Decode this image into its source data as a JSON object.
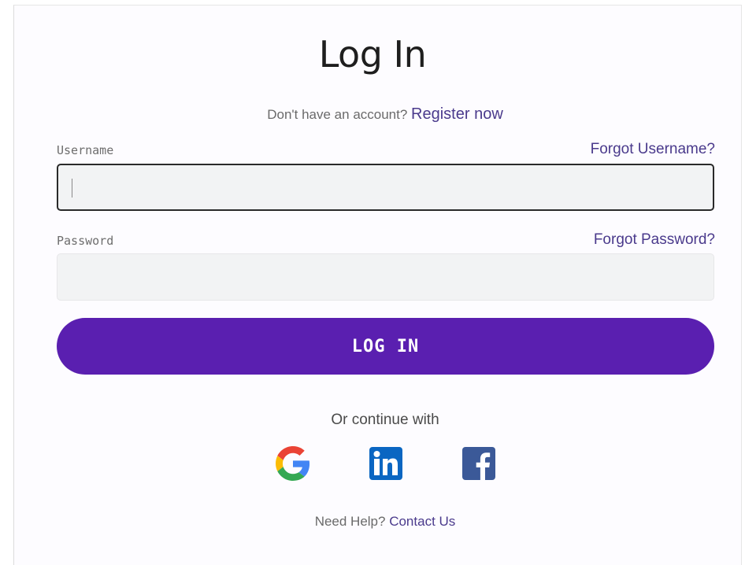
{
  "page": {
    "title": "Log In"
  },
  "register": {
    "prompt": "Don't have an account?",
    "link": "Register now"
  },
  "username": {
    "label": "Username",
    "forgot_link": "Forgot Username?",
    "value": ""
  },
  "password": {
    "label": "Password",
    "forgot_link": "Forgot Password?",
    "value": ""
  },
  "login_button": {
    "label": "LOG IN"
  },
  "social": {
    "prompt": "Or continue with",
    "providers": [
      {
        "name": "Google",
        "icon": "google-icon"
      },
      {
        "name": "LinkedIn",
        "icon": "linkedin-icon"
      },
      {
        "name": "Facebook",
        "icon": "facebook-icon"
      }
    ]
  },
  "help": {
    "prompt": "Need Help?",
    "link": "Contact Us"
  },
  "colors": {
    "accent": "#5a1fb0",
    "link": "#4a3a8c",
    "input_bg": "#f2f3f4"
  }
}
